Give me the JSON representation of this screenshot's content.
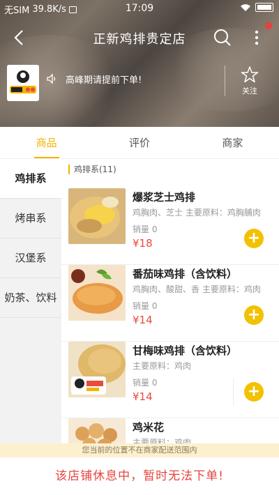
{
  "status_bar": {
    "carrier": "无SIM",
    "speed": "39.8K/s",
    "time": "17:09"
  },
  "header": {
    "title": "正新鸡排贵定店",
    "notice": "高峰期请提前下单!",
    "follow_label": "关注"
  },
  "tabs": [
    {
      "label": "商品"
    },
    {
      "label": "评价"
    },
    {
      "label": "商家"
    }
  ],
  "sidebar": {
    "items": [
      {
        "label": "鸡排系"
      },
      {
        "label": "烤串系"
      },
      {
        "label": "汉堡系"
      },
      {
        "label": "奶茶、饮料"
      }
    ]
  },
  "section": {
    "title": "鸡排系(11)"
  },
  "products": [
    {
      "name": "爆浆芝士鸡排",
      "desc": "鸡胸肉、芝士 主要原料：鸡胸脯肉",
      "sales": "销量 0",
      "price": "¥18"
    },
    {
      "name": "番茄味鸡排（含饮料）",
      "desc": "鸡胸肉、酸甜、香 主要原料：鸡肉",
      "sales": "销量 0",
      "price": "¥14"
    },
    {
      "name": "甘梅味鸡排（含饮料）",
      "desc": "主要原料：鸡肉",
      "sales": "销量 0",
      "price": "¥14"
    },
    {
      "name": "鸡米花",
      "desc": "主要原料：鸡肉",
      "sales": "",
      "price": ""
    }
  ],
  "add_symbol": "+",
  "footer": {
    "range_notice": "您当前的位置不在商家配送范围内",
    "closed_notice": "该店铺休息中，暂时无法下单!"
  },
  "colors": {
    "accent": "#f2b300",
    "price": "#e84c3d",
    "closed": "#e5453e"
  }
}
